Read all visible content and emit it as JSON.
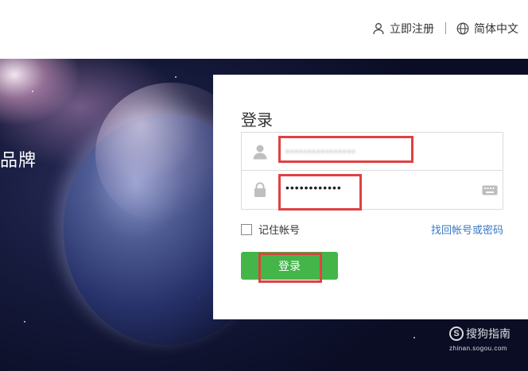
{
  "header": {
    "register_label": "立即注册",
    "language_label": "简体中文"
  },
  "banner": {
    "partial_text": "品牌"
  },
  "login": {
    "title": "登录",
    "username_value": "••••••••••••••••",
    "password_value": "••••••••••••",
    "remember_label": "记住帐号",
    "forgot_label": "找回帐号或密码",
    "submit_label": "登录"
  },
  "watermark": {
    "brand": "搜狗指南",
    "logo_letter": "S",
    "url": "zhinan.sogou.com"
  },
  "colors": {
    "primary_button": "#44b549",
    "highlight_box": "#e04141",
    "link": "#3a78c3"
  }
}
